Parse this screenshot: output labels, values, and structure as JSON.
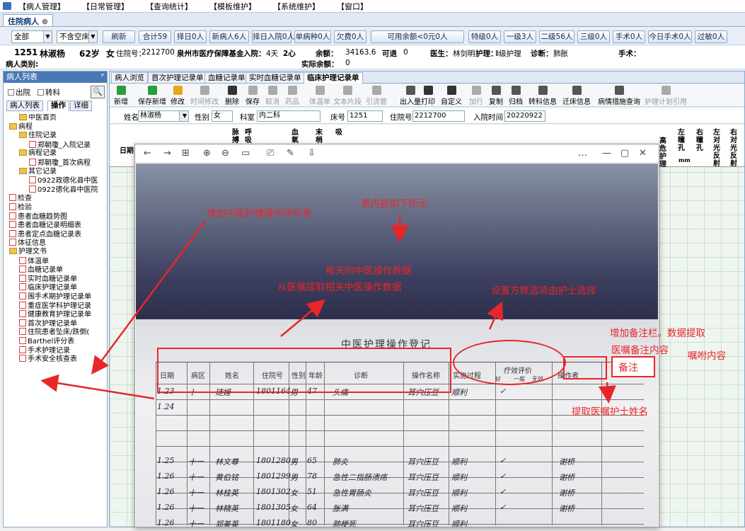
{
  "menu": [
    "【病人管理】",
    "【日常管理】",
    "【查询统计】",
    "【模板维护】",
    "【系统维护】",
    "【窗口】"
  ],
  "app_tab": "住院病人",
  "filters": {
    "dept": "全部",
    "room": "不含空床",
    "buttons": [
      "刷新",
      "合计59",
      "择日0人",
      "新病人6人",
      "择日入院0人",
      "单病种0人",
      "欠费0人",
      "可用余额<0元0人",
      "特级0人",
      "一级3人",
      "二级56人",
      "三级0人",
      "手术0人",
      "今日手术0人",
      "过敏0人"
    ]
  },
  "patient": {
    "bed": "1251",
    "name": "林淑杨",
    "age": "62岁",
    "sex": "女",
    "adm_label": "住院号：",
    "adm_no": "2212700",
    "insurance": "泉州市医疗保障基金",
    "in_label": "入院：",
    "in_days": "4天",
    "ward": "2心",
    "balance_label": "余额：",
    "balance": "34163.6",
    "deposit_label": "可退",
    "deposit": "0",
    "doctor_label": "医生：",
    "doctor": "林剑明",
    "nursing_label": "护理：",
    "nursing": "Ⅱ级护理",
    "diag_label": "诊断：",
    "diag": "肺胀",
    "surgery_label": "手术：",
    "category_label": "病人类别:",
    "actual_label": "实际余额：",
    "actual": "0"
  },
  "left": {
    "title": "病人列表",
    "pin": "ᴾ",
    "chk1": "出院",
    "chk2": "转科",
    "tabs": [
      "病人列表",
      "操作",
      "详细"
    ],
    "tree": [
      "中医首页",
      "病程",
      "住院记录",
      "郑朝瓊_入院记录",
      "病程记录",
      "郑朝瓊_首次病程",
      "其它记录",
      "0922政德化县中医",
      "0922德化县中医院",
      "检查",
      "检验",
      "患者血糖趋势图",
      "患者血糖记录明细表",
      "患者定点血糖记录表",
      "体征信息",
      "护理文书",
      "体温单",
      "血糖记录单",
      "实时血糖记录单",
      "临床护理记录单",
      "围手术期护理记录单",
      "重症医学科护理记录",
      "健康教育护理记录单",
      "首次护理记录单",
      "住院患者坠床/跌倒(",
      "Barthel评分表",
      "手术护理记录",
      "手术安全核查表"
    ]
  },
  "rtabs": [
    "病人浏览",
    "首次护理记录单",
    "血糖记录单",
    "实时血糖记录单",
    "临床护理记录单"
  ],
  "toolbar": [
    "新增",
    "保存新增",
    "修改",
    "时间修改",
    "删除",
    "保存",
    "取消",
    "药品",
    "体温单",
    "文本片段",
    "引流管",
    "出入量",
    "打印",
    "自定义",
    "加行",
    "复制",
    "归档",
    "转科信息",
    "迁床信息",
    "病情措施查询",
    "护理计划引用"
  ],
  "form": {
    "name_l": "姓名",
    "name": "林淑杨",
    "sex_l": "性别",
    "sex": "女",
    "dept_l": "科室",
    "dept": "内二科",
    "bed_l": "床号",
    "bed": "1251",
    "adm_l": "住院号",
    "adm": "2212700",
    "time_l": "入院时间",
    "time": "20220922"
  },
  "grid": {
    "date": "日期",
    "cols": [
      "脉搏",
      "呼吸",
      "血氧",
      "末梢",
      "吸",
      "左瞳孔",
      "右瞳孔",
      "左对光反射",
      "右对光反射",
      "高危护理"
    ],
    "mm": "mm"
  },
  "viewer": {
    "controls": [
      "←",
      "→",
      "⊞",
      "⊕",
      "⊖",
      "▭",
      "⎚",
      "✎",
      "⇩",
      "…",
      "—",
      "▢",
      "✕"
    ]
  },
  "sheet": {
    "title": "中医护理操作登记",
    "headers": [
      "日期",
      "病区",
      "姓名",
      "住院号",
      "性别",
      "年龄",
      "诊断",
      "操作名称",
      "实施过程",
      "疗效评价",
      "好",
      "一般",
      "无效",
      "操作者"
    ],
    "rows": [
      [
        "1.23",
        "十一",
        "琏姪",
        "1801164",
        "男",
        "47",
        "头痛",
        "耳穴压豆",
        "顺利",
        "✓",
        ""
      ],
      [
        "1.24",
        "",
        "",
        "",
        "",
        "",
        "",
        "",
        "",
        "",
        ""
      ],
      [
        "1.25",
        "十一",
        "林文尊",
        "1801280",
        "男",
        "65",
        "肺炎",
        "耳穴压豆",
        "顺利",
        "✓",
        "谢桥"
      ],
      [
        "1.26",
        "十一",
        "黄伯铭",
        "1801299",
        "男",
        "78",
        "急性二指肠溃疡",
        "耳穴压豆",
        "顺利",
        "✓",
        "谢桥"
      ],
      [
        "1.26",
        "十一",
        "林桂英",
        "1801302",
        "女",
        "51",
        "急性胃肠炎",
        "耳穴压豆",
        "顺利",
        "✓",
        "谢桥"
      ],
      [
        "1.26",
        "十一",
        "林精英",
        "1801305",
        "女",
        "64",
        "胀满",
        "耳穴压豆",
        "顺利",
        "✓",
        "谢桥"
      ],
      [
        "1.26",
        "十一",
        "郑美英",
        "1801180",
        "女",
        "80",
        "肺梗死",
        "耳穴压豆",
        "顺利",
        "",
        ""
      ]
    ]
  },
  "annotations": {
    "a1": "增加中医护理操作评价表",
    "a2": "表内容如下所示",
    "a3": "每天的中医操作数据",
    "a4": "从医嘱提取相关中医操作数据",
    "a5": "设置方框选项由护士选择",
    "a6": "增加备注栏。数据提取",
    "a7": "医嘱备注内容",
    "a8": "嘱咐内容",
    "a9": "备注",
    "a10": "提取医嘱护士姓名"
  },
  "colors": {
    "annotation": "#e8262a",
    "accent": "#4a78b6"
  }
}
